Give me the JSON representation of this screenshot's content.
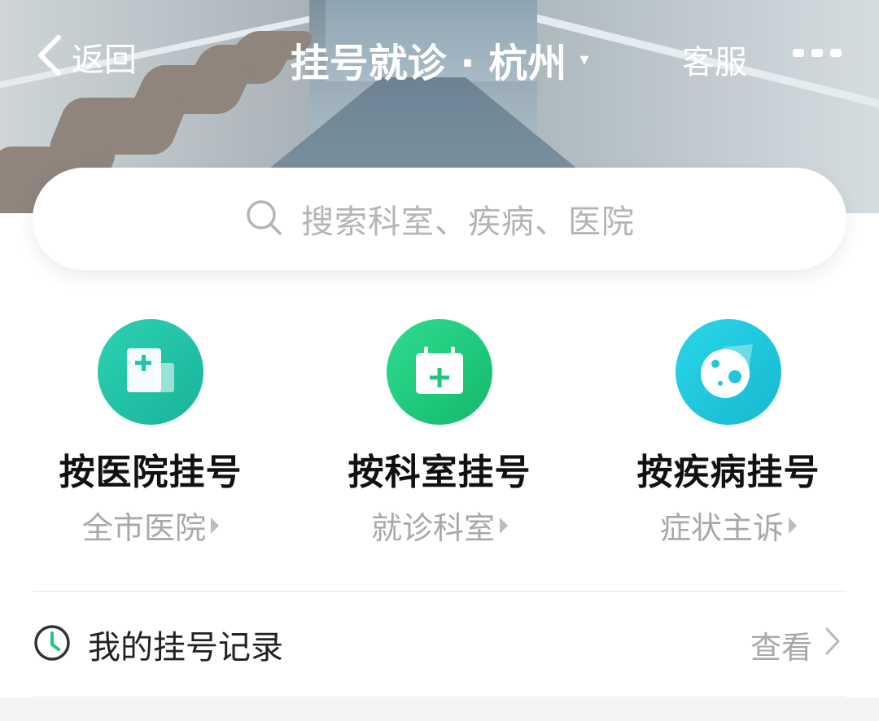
{
  "nav": {
    "back_label": "返回",
    "title": "挂号就诊 · 杭州",
    "title_caret": "▾",
    "service_label": "客服"
  },
  "search": {
    "placeholder": "搜索科室、疾病、医院"
  },
  "entries": [
    {
      "label": "按医院挂号",
      "sub": "全市医院",
      "icon": "hospital-icon",
      "color": "#22c3a6"
    },
    {
      "label": "按科室挂号",
      "sub": "就诊科室",
      "icon": "calendar-plus-icon",
      "color": "#1fc77e"
    },
    {
      "label": "按疾病挂号",
      "sub": "症状主诉",
      "icon": "virus-icon",
      "color": "#22c6d8"
    }
  ],
  "record": {
    "label": "我的挂号记录",
    "view_label": "查看"
  }
}
